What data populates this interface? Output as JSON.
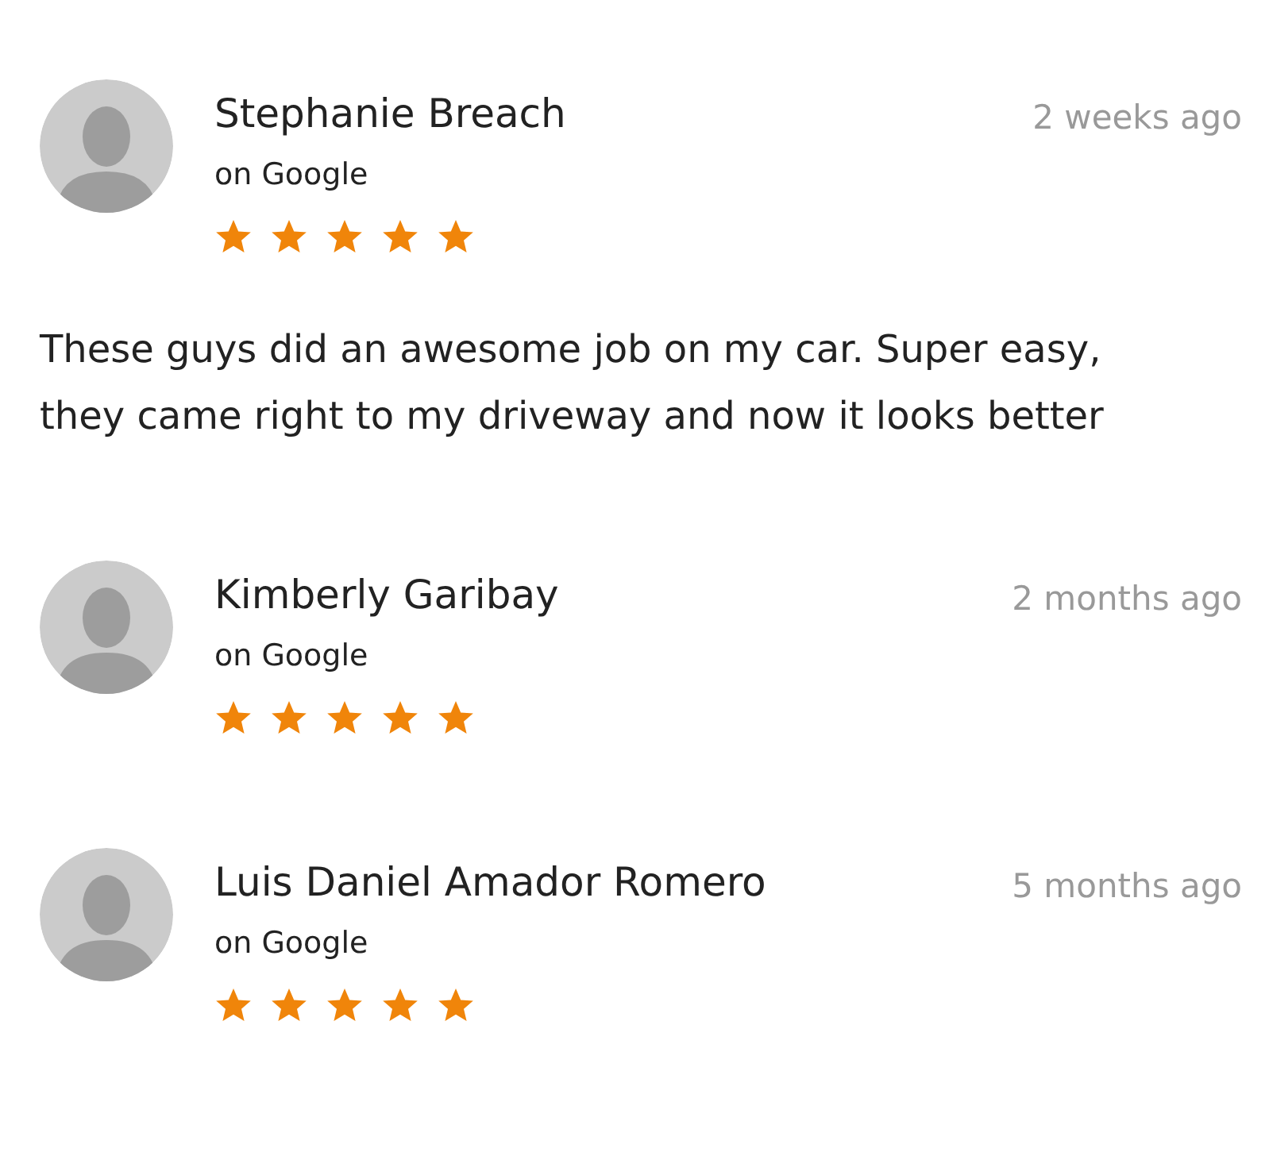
{
  "reviews": [
    {
      "name": "Stephanie Breach",
      "source": "on Google",
      "time": "2 weeks ago",
      "stars": 5,
      "text": "These guys did an awesome job on my car. Super easy, they came right to my driveway and now it looks better"
    },
    {
      "name": "Kimberly Garibay",
      "source": "on Google",
      "time": "2 months ago",
      "stars": 5
    },
    {
      "name": "Luis Daniel Amador Romero",
      "source": "on Google",
      "time": "5 months ago",
      "stars": 5
    }
  ]
}
